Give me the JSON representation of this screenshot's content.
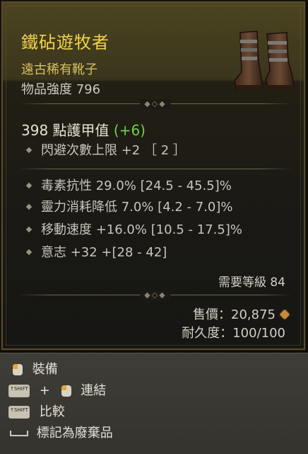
{
  "item": {
    "name": "鐵砧遊牧者",
    "rarity_type": "遠古稀有靴子",
    "item_power": "物品強度 796",
    "armor": "398 點護甲值",
    "armor_bonus": "(+6)",
    "implicit": "閃避次數上限 +2 ［ 2 ］",
    "affixes": [
      "毒素抗性 29.0% [24.5 - 45.5]%",
      "靈力消耗降低 7.0% [4.2 - 7.0]%",
      "移動速度 +16.0% [10.5 - 17.5]%",
      "意志 +32 +[28 - 42]"
    ],
    "required_level": "需要等級 84",
    "price": "售價：20,875",
    "durability": "耐久度：100/100",
    "colors": {
      "title": "#f2d34a",
      "subtitle": "#d8c060",
      "bonus": "#6fd14a"
    }
  },
  "actions": {
    "equip": "裝備",
    "link": "連結",
    "compare": "比較",
    "mark_junk": "標記為廢棄品",
    "plus": "+",
    "shift_key": "↑SHIFT"
  },
  "icons": {
    "item": "boots-icon",
    "gold": "gold-coin-icon",
    "mouse": "mouse-button-icon",
    "shift": "shift-key-icon",
    "space": "spacebar-icon"
  }
}
